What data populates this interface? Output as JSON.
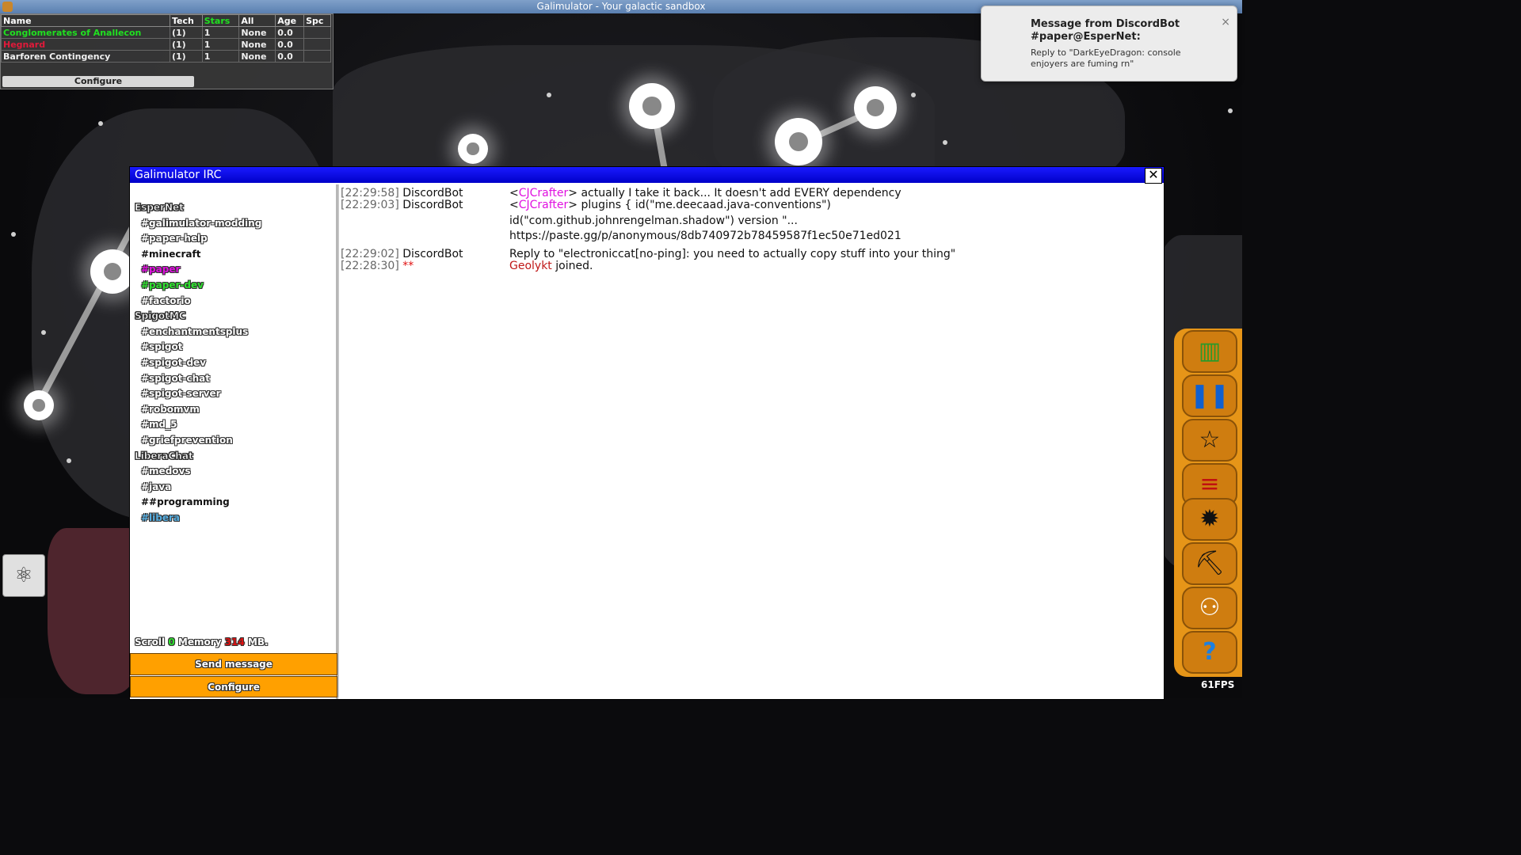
{
  "window": {
    "title": "Galimulator - Your galactic sandbox"
  },
  "empire_table": {
    "columns": [
      "Name",
      "Tech",
      "Stars",
      "All",
      "Age",
      "Spc"
    ],
    "rows": [
      {
        "name": "Conglomerates of Anallecon",
        "tech": "(1)",
        "stars": "1",
        "all": "None",
        "age": "0.0",
        "spc": "",
        "color": "#20e020"
      },
      {
        "name": "Hegnard",
        "tech": "(1)",
        "stars": "1",
        "all": "None",
        "age": "0.0",
        "spc": "",
        "color": "#e01a3a"
      },
      {
        "name": "Barforen Contingency",
        "tech": "(1)",
        "stars": "1",
        "all": "None",
        "age": "0.0",
        "spc": "",
        "color": "#f0f0f0"
      }
    ],
    "configure_label": "Configure"
  },
  "notification": {
    "title": "Message from DiscordBot #paper@EsperNet:",
    "body": "Reply to \"DarkEyeDragon: console enjoyers are fuming rn\"",
    "close": "×"
  },
  "irc": {
    "title": "Galimulator IRC",
    "close": "✕",
    "networks": [
      {
        "name": "EsperNet",
        "channels": [
          {
            "name": "#galimulator-modding",
            "style": "normal"
          },
          {
            "name": "#paper-help",
            "style": "normal"
          },
          {
            "name": "#minecraft",
            "style": "bold"
          },
          {
            "name": "#paper",
            "style": "active"
          },
          {
            "name": "#paper-dev",
            "style": "dev"
          },
          {
            "name": "#factorio",
            "style": "normal"
          }
        ]
      },
      {
        "name": "SpigotMC",
        "channels": [
          {
            "name": "#enchantmentsplus",
            "style": "normal"
          },
          {
            "name": "#spigot",
            "style": "normal"
          },
          {
            "name": "#spigot-dev",
            "style": "normal"
          },
          {
            "name": "#spigot-chat",
            "style": "normal"
          },
          {
            "name": "#spigot-server",
            "style": "normal"
          },
          {
            "name": "#robomvm",
            "style": "normal"
          },
          {
            "name": "#md_5",
            "style": "normal"
          },
          {
            "name": "#griefprevention",
            "style": "normal"
          }
        ]
      },
      {
        "name": "LiberaChat",
        "channels": [
          {
            "name": "#medovs",
            "style": "normal"
          },
          {
            "name": "#java",
            "style": "normal"
          },
          {
            "name": "##programming",
            "style": "bold"
          },
          {
            "name": "#libera",
            "style": "libera"
          }
        ]
      }
    ],
    "status": {
      "scroll_label": "Scroll",
      "scroll_value": "0",
      "memory_label": "Memory",
      "memory_value": "314",
      "memory_unit": "MB."
    },
    "send_label": "Send message",
    "configure_label": "Configure",
    "messages": [
      {
        "ts": "[22:29:58]",
        "sender": "DiscordBot",
        "pre": "<",
        "nick": "CJCrafter",
        "post": "> actually I take it back... It doesn't add EVERY dependency"
      },
      {
        "ts": "[22:29:03]",
        "sender": "DiscordBot",
        "pre": "<",
        "nick": "CJCrafter",
        "post": "> plugins {    id(\"me.deecaad.java-conventions\")"
      },
      {
        "cont": "id(\"com.github.johnrengelman.shadow\") version \"..."
      },
      {
        "cont": " https://paste.gg/p/anonymous/8db740972b78459587f1ec50e71ed021"
      },
      {
        "ts": "[22:29:02]",
        "sender": "DiscordBot",
        "text": "Reply to \"electroniccat[no-ping]: you need to actually copy stuff into your thing\""
      },
      {
        "ts": "[22:28:30]",
        "sender": "**",
        "join_nick": "Geolykt",
        "join_text": " joined."
      }
    ]
  },
  "toolbar": {
    "buttons": [
      {
        "icon": "book-icon",
        "glyph": "▥"
      },
      {
        "icon": "pause-icon",
        "glyph": "❚❚"
      },
      {
        "icon": "star-icon",
        "glyph": "☆"
      },
      {
        "icon": "stats-icon",
        "glyph": "≡"
      },
      {
        "icon": "gear-icon",
        "glyph": "✹"
      },
      {
        "icon": "construction-icon",
        "glyph": "⛏"
      },
      {
        "icon": "people-icon",
        "glyph": "⚇"
      },
      {
        "icon": "help-icon",
        "glyph": "?"
      }
    ]
  },
  "fps": "61FPS",
  "left_tool": {
    "icon": "network-icon",
    "glyph": "⚛"
  }
}
